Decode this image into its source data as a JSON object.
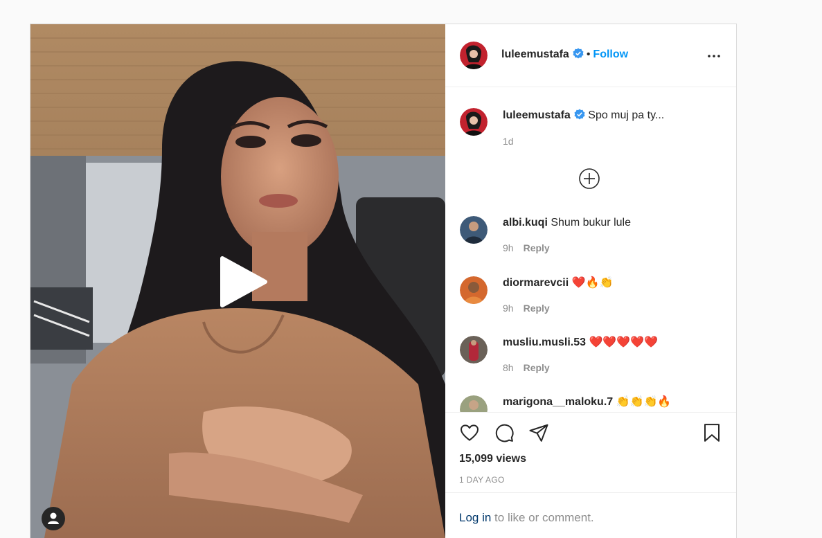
{
  "post": {
    "author": {
      "username": "luleemustafa",
      "verified": true,
      "follow_label": "Follow",
      "separator": "•"
    },
    "caption": {
      "username": "luleemustafa",
      "text": "Spo muj pa ty...",
      "time": "1d"
    },
    "comments": [
      {
        "username": "albi.kuqi",
        "text": "Shum bukur lule",
        "time": "9h",
        "reply_label": "Reply"
      },
      {
        "username": "diormarevcii",
        "text": "❤️🔥👏",
        "time": "9h",
        "reply_label": "Reply"
      },
      {
        "username": "musliu.musli.53",
        "text": "❤️❤️❤️❤️❤️",
        "time": "8h",
        "reply_label": "Reply"
      },
      {
        "username": "marigona__maloku.7",
        "text": "👏👏👏🔥",
        "time": "",
        "reply_label": ""
      }
    ],
    "stats": {
      "views": "15,099 views",
      "date": "1 DAY AGO"
    },
    "login_prompt": {
      "link": "Log in",
      "text": " to like or comment."
    }
  },
  "icons": {
    "play": "play-icon",
    "user_tag": "user-tag-icon",
    "more": "more-options-icon",
    "load_more": "load-more-comments-icon",
    "like": "heart-icon",
    "comment": "comment-icon",
    "share": "share-icon",
    "save": "bookmark-icon"
  },
  "colors": {
    "link_blue": "#0095f6",
    "verified_blue": "#3897f0",
    "muted_gray": "#8e8e8e",
    "border": "#dbdbdb"
  }
}
